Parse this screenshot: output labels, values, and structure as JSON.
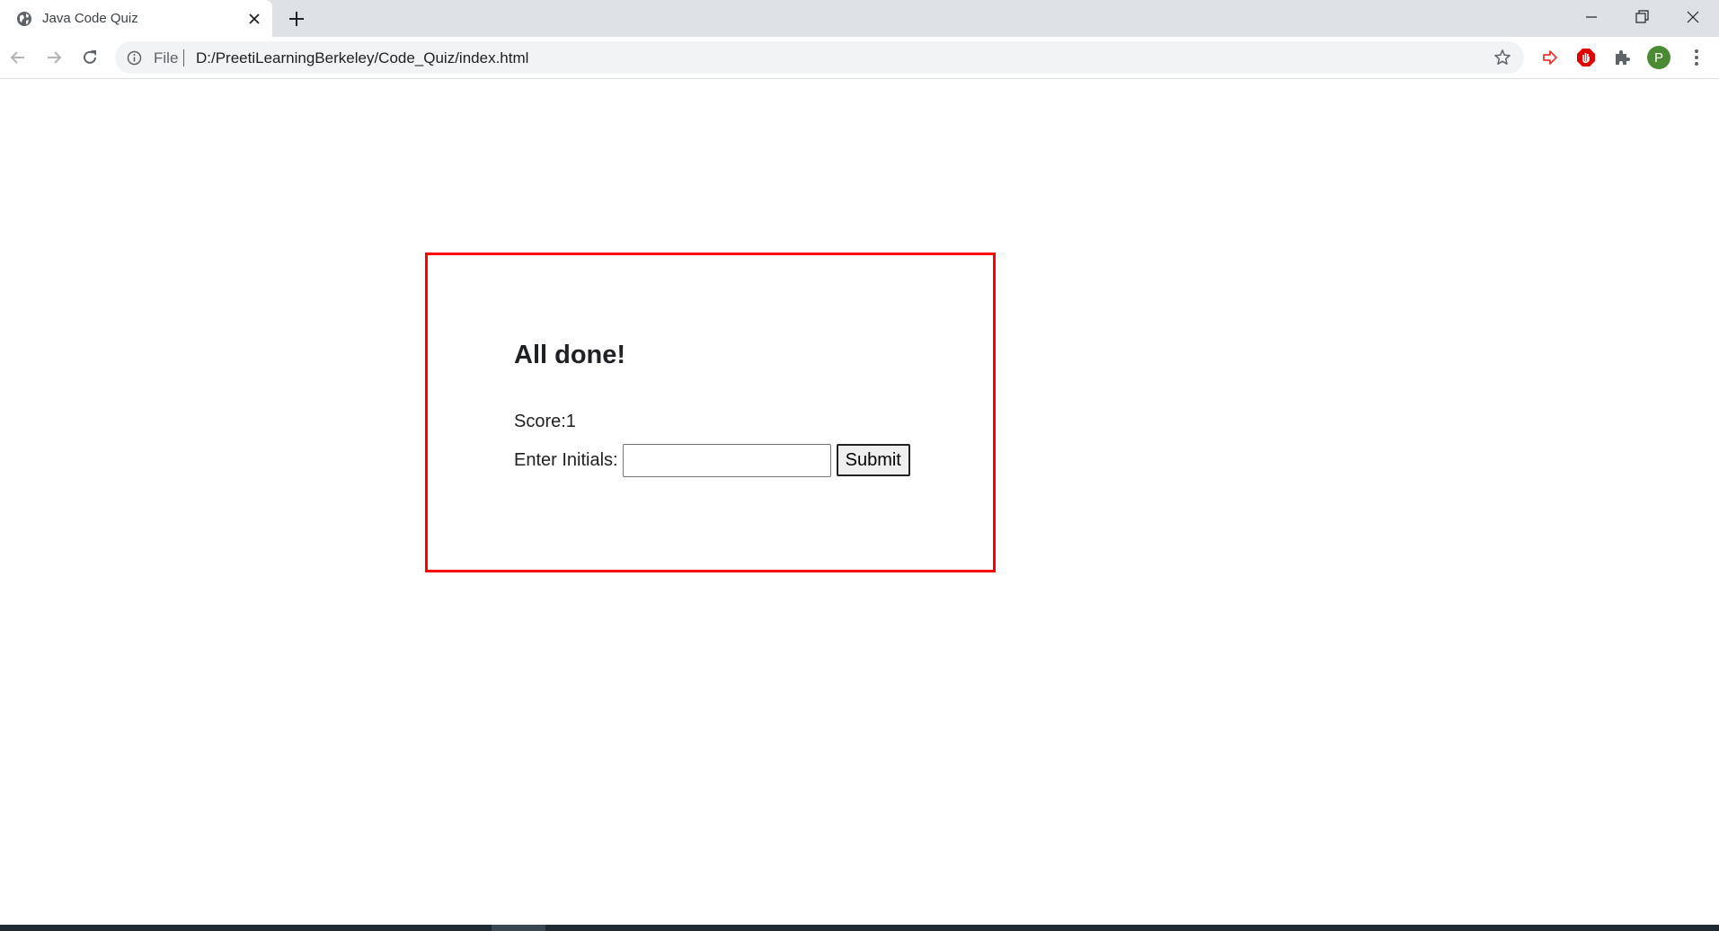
{
  "browser": {
    "tab": {
      "title": "Java Code Quiz"
    },
    "address_bar": {
      "scheme_label": "File",
      "url": "D:/PreetiLearningBerkeley/Code_Quiz/index.html"
    },
    "profile_initial": "P"
  },
  "quiz": {
    "heading": "All done!",
    "score_text": "Score:1",
    "initials_label": "Enter Initials:",
    "initials_value": "",
    "submit_label": "Submit"
  },
  "colors": {
    "quiz_border": "#ff0000",
    "avatar": "#4a8a33",
    "tabstrip": "#dee1e6"
  }
}
